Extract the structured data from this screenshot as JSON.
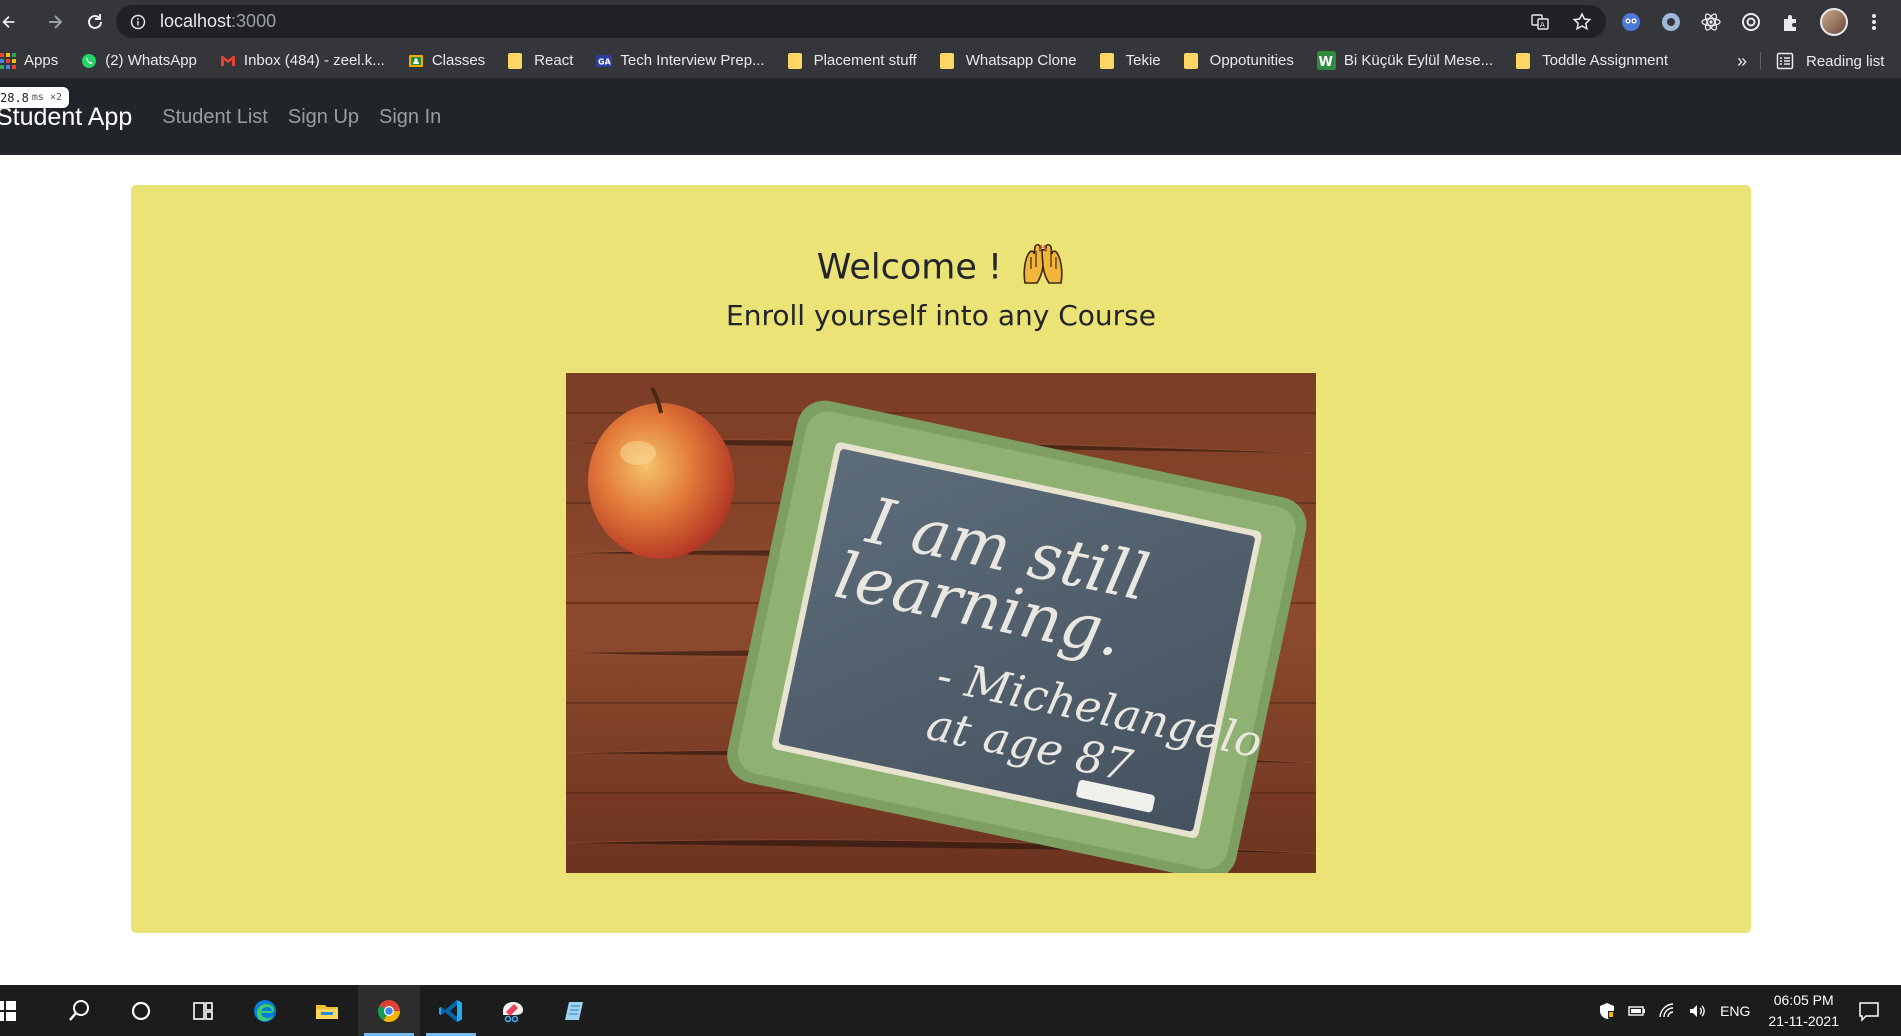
{
  "browser": {
    "url_host": "localhost",
    "url_port": ":3000",
    "bookmarks": [
      {
        "label": "Apps",
        "icon": "apps-grid-icon"
      },
      {
        "label": "(2) WhatsApp",
        "icon": "whatsapp-icon"
      },
      {
        "label": "Inbox (484) - zeel.k...",
        "icon": "gmail-icon"
      },
      {
        "label": "Classes",
        "icon": "google-classroom-icon"
      },
      {
        "label": "React",
        "icon": "folder-icon"
      },
      {
        "label": "Tech Interview Prep...",
        "icon": "geeksforgeeks-icon"
      },
      {
        "label": "Placement stuff",
        "icon": "folder-icon"
      },
      {
        "label": "Whatsapp Clone",
        "icon": "folder-icon"
      },
      {
        "label": "Tekie",
        "icon": "folder-icon"
      },
      {
        "label": "Oppotunities",
        "icon": "folder-icon"
      },
      {
        "label": "Bi Küçük Eylül Mese...",
        "icon": "wattpad-icon"
      },
      {
        "label": "Toddle Assignment",
        "icon": "folder-icon"
      }
    ],
    "bookmarks_overflow": "»",
    "reading_list": "Reading list"
  },
  "perf_overlay": {
    "value": "28.8",
    "unit": "ms ×2"
  },
  "navbar": {
    "brand": "Student App",
    "links": [
      "Student List",
      "Sign Up",
      "Sign In"
    ]
  },
  "hero": {
    "title": "Welcome !",
    "emoji": "raising-hands-emoji",
    "subtitle": "Enroll yourself into any Course",
    "chalkboard_lines": [
      "I am still",
      "learning.",
      "- Michelangelo",
      "at age 87"
    ]
  },
  "taskbar": {
    "apps": [
      "windows-start-icon",
      "search-icon",
      "cortana-icon",
      "task-view-icon",
      "edge-icon",
      "file-explorer-icon",
      "chrome-icon",
      "vscode-icon",
      "snip-sketch-icon",
      "notepad-icon"
    ],
    "language": "ENG",
    "time": "06:05 PM",
    "date": "21-11-2021"
  },
  "colors": {
    "chrome_dark": "#35363a",
    "omnibox": "#202124",
    "navbar": "#212529",
    "card": "#ece376",
    "taskbar": "#1c1c1c"
  }
}
